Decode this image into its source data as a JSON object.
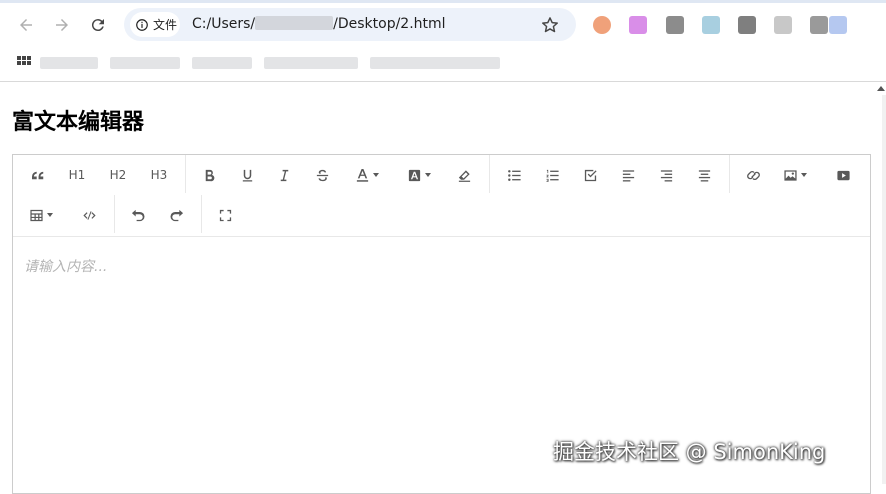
{
  "browser": {
    "security_chip_label": "文件",
    "url_prefix": "C:/Users/",
    "url_suffix": "/Desktop/2.html",
    "extensions": [
      {
        "name": "ext-orange",
        "color": "#f0a17a"
      },
      {
        "name": "ext-purple",
        "color": "#d98ee8"
      },
      {
        "name": "ext-gray",
        "color": "#8c8c8c"
      },
      {
        "name": "ext-lightblue",
        "color": "#a8cfe0"
      },
      {
        "name": "ext-darkgray",
        "color": "#7f7f7f"
      },
      {
        "name": "ext-silver",
        "color": "#c8c8c8"
      },
      {
        "name": "ext-gray2",
        "color": "#9a9a9a"
      },
      {
        "name": "ext-periwinkle",
        "color": "#b5c8f0"
      }
    ]
  },
  "page": {
    "title": "富文本编辑器",
    "placeholder": "请输入内容..."
  },
  "toolbar": {
    "h1": "H1",
    "h2": "H2",
    "h3": "H3"
  },
  "watermark": "掘金技术社区 @ SimonKing"
}
